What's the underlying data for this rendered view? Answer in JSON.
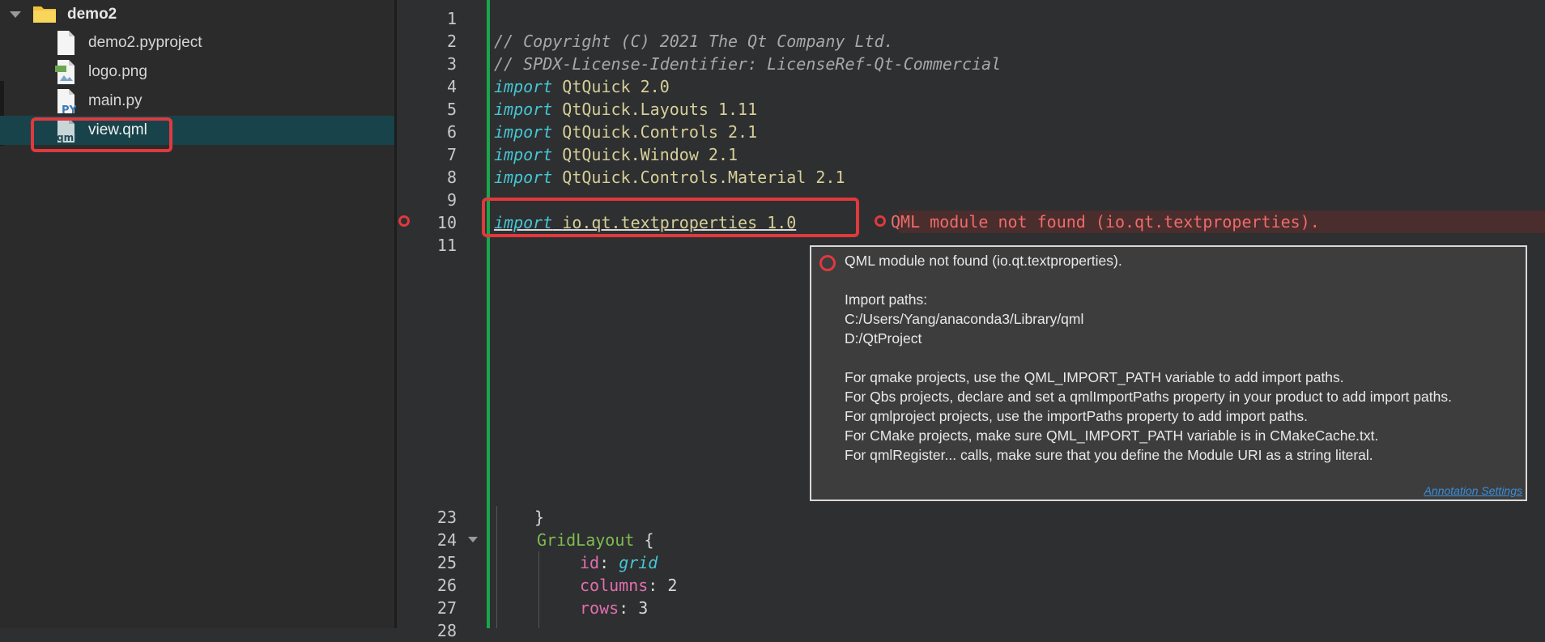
{
  "sidebar": {
    "root_folder": "demo2",
    "files": [
      {
        "name": "demo2.pyproject",
        "icon": "file-icon"
      },
      {
        "name": "logo.png",
        "icon": "image-file-icon"
      },
      {
        "name": "main.py",
        "icon": "python-file-icon"
      },
      {
        "name": "view.qml",
        "icon": "qml-file-icon",
        "selected": true
      }
    ]
  },
  "editor": {
    "line_numbers": [
      "1",
      "2",
      "3",
      "4",
      "5",
      "6",
      "7",
      "8",
      "9",
      "10",
      "11",
      "23",
      "24",
      "25",
      "26",
      "27",
      "28"
    ],
    "lines": {
      "l2": "// Copyright (C) 2021 The Qt Company Ltd.",
      "l3": "// SPDX-License-Identifier: LicenseRef-Qt-Commercial",
      "import_kw": "import",
      "l4_mod": "QtQuick 2.0",
      "l5_mod": "QtQuick.Layouts 1.11",
      "l6_mod": "QtQuick.Controls 2.1",
      "l7_mod": "QtQuick.Window 2.1",
      "l8_mod": "QtQuick.Controls.Material 2.1",
      "l10_mod": "io.qt.textproperties 1.0",
      "l24_type": "GridLayout",
      "l24_brace": " {",
      "l25_prop": "id",
      "l25_val": "grid",
      "l26_prop": "columns",
      "l26_val": "2",
      "l27_prop": "rows",
      "l27_val": "3",
      "colon": ": "
    },
    "inline_error": "QML module not found (io.qt.textproperties)."
  },
  "tooltip": {
    "title": "QML module not found (io.qt.textproperties).",
    "import_paths_label": "Import paths:",
    "path1": "C:/Users/Yang/anaconda3/Library/qml",
    "path2": "D:/QtProject",
    "hints": [
      "For qmake projects, use the QML_IMPORT_PATH variable to add import paths.",
      "For Qbs projects, declare and set a qmlImportPaths property in your product to add import paths.",
      "For qmlproject projects, use the importPaths property to add import paths.",
      "For CMake projects, make sure QML_IMPORT_PATH variable is in CMakeCache.txt.",
      "For qmlRegister... calls, make sure that you define the Module URI as a string literal."
    ],
    "settings_link": "Annotation Settings"
  },
  "colors": {
    "selection": "#18434a",
    "error": "#e0393e",
    "keyword": "#45c6d6",
    "module": "#d6cf9a",
    "type": "#7fbb53",
    "property": "#e06fb0"
  }
}
